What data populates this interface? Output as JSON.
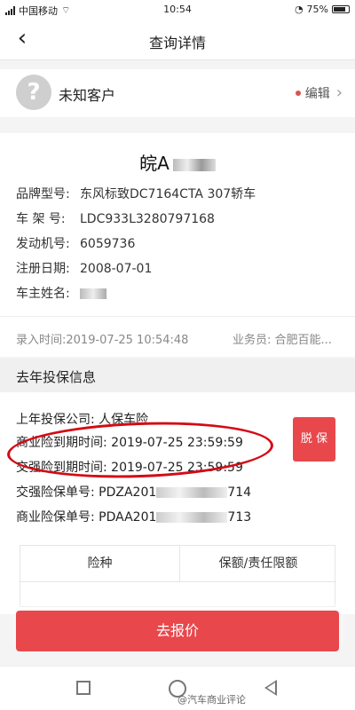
{
  "status_bar": {
    "carrier": "中国移动",
    "time": "10:54",
    "battery": "75%"
  },
  "nav": {
    "back_icon": "chevron-left-icon",
    "title": "查询详情"
  },
  "customer": {
    "avatar_icon": "question-mark-icon",
    "avatar_glyph": "?",
    "name": "未知客户",
    "edit_label": "编辑"
  },
  "vehicle": {
    "plate_visible": "皖A",
    "fields": [
      {
        "label": "品牌型号:",
        "value": "东风标致DC7164CTA 307轿车"
      },
      {
        "label": "车 架 号:",
        "value": "LDC933L3280797168"
      },
      {
        "label": "发动机号:",
        "value": "6059736"
      },
      {
        "label": "注册日期:",
        "value": "2008-07-01"
      },
      {
        "label": "车主姓名:",
        "value": ""
      }
    ],
    "entry_time": "录入时间:2019-07-25 10:54:48",
    "salesperson": "业务员: 合肥百能..."
  },
  "last_year": {
    "section_title": "去年投保信息",
    "company": "上年投保公司: 人保车险",
    "commercial_expiry": "商业险到期时间: 2019-07-25 23:59:59",
    "compulsory_expiry": "交强险到期时间: 2019-07-25 23:59:59",
    "compulsory_policy_prefix": "交强险保单号: PDZA201",
    "compulsory_policy_suffix": "714",
    "commercial_policy_prefix": "商业险保单号: PDAA201",
    "commercial_policy_suffix": "713",
    "unprotect_label": "脱 保",
    "table_headers": [
      "险种",
      "保额/责任限额"
    ]
  },
  "quote_button": "去报价",
  "watermark": "@汽车商业评论",
  "colors": {
    "accent": "#e8484c",
    "annotation": "#d40a14"
  }
}
